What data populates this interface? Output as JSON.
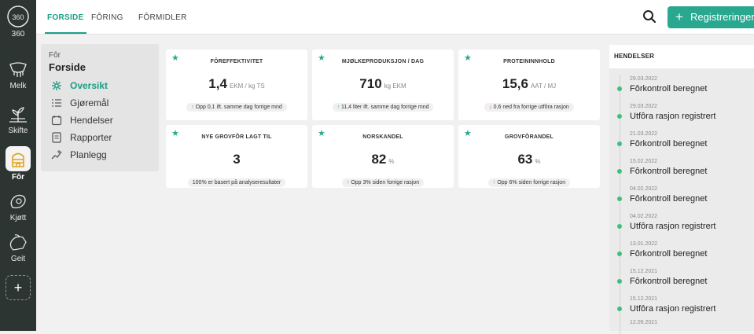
{
  "rail": {
    "items": [
      {
        "label": "360",
        "icon": "360-icon"
      },
      {
        "label": "Melk",
        "icon": "udder-icon"
      },
      {
        "label": "Skifte",
        "icon": "field-plant-icon"
      },
      {
        "label": "Fôr",
        "icon": "feed-silo-icon",
        "active": true
      },
      {
        "label": "Kjøtt",
        "icon": "meat-icon"
      },
      {
        "label": "Geit",
        "icon": "goat-icon"
      }
    ],
    "add_label": "+"
  },
  "topbar": {
    "tabs": [
      "FORSIDE",
      "FÔRING",
      "FÔRMIDLER"
    ],
    "active_tab": 0,
    "register_label": "Registreringer",
    "register_plus": "+"
  },
  "submenu": {
    "breadcrumb": "Fôr",
    "title": "Forside",
    "items": [
      {
        "label": "Oversikt",
        "icon": "overview-icon",
        "active": true
      },
      {
        "label": "Gjøremål",
        "icon": "checklist-icon"
      },
      {
        "label": "Hendelser",
        "icon": "calendar-icon"
      },
      {
        "label": "Rapporter",
        "icon": "report-icon"
      },
      {
        "label": "Planlegg",
        "icon": "plan-chart-icon"
      }
    ]
  },
  "cards": [
    {
      "title": "FÔREFFEKTIVITET",
      "value": "1,4",
      "unit": "EKM / kg TS",
      "badge": "Opp 0,1 ift. samme dag forrige mnd",
      "trend": "up",
      "arrow": "↑"
    },
    {
      "title": "MJØLKEPRODUKSJON / DAG",
      "value": "710",
      "unit": "kg EKM",
      "badge": "11,4 liter ift. samme dag forrige mnd",
      "trend": "up",
      "arrow": "↑"
    },
    {
      "title": "PROTEININNHOLD",
      "value": "15,6",
      "unit": "AAT / MJ",
      "badge": "0,6 ned fra forrige utfôra rasjon",
      "trend": "down",
      "arrow": "↓"
    },
    {
      "title": "NYE GROVFÔR LAGT TIL",
      "value": "3",
      "unit": "",
      "badge": "100% er basert på analyseresultater",
      "trend": "none",
      "arrow": ""
    },
    {
      "title": "NORSKANDEL",
      "value": "82",
      "unit": "%",
      "badge": "Opp 3% siden forrige rasjon",
      "trend": "up",
      "arrow": "↑"
    },
    {
      "title": "GROVFÔRANDEL",
      "value": "63",
      "unit": "%",
      "badge": "Opp 6% siden forrige rasjon",
      "trend": "up",
      "arrow": "↑"
    }
  ],
  "colors": {
    "accent": "#2aa88f",
    "rail": "#2c3532",
    "down": "#e23b3b",
    "event_dot": "#3fbf7f"
  },
  "events": {
    "heading": "HENDELSER",
    "items": [
      {
        "date": "29.03.2022",
        "title": "Fôrkontroll beregnet"
      },
      {
        "date": "29.03.2022",
        "title": "Utfôra rasjon registrert"
      },
      {
        "date": "21.03.2022",
        "title": "Fôrkontroll beregnet"
      },
      {
        "date": "15.02.2022",
        "title": "Fôrkontroll beregnet"
      },
      {
        "date": "04.02.2022",
        "title": "Fôrkontroll beregnet"
      },
      {
        "date": "04.02.2022",
        "title": "Utfôra rasjon registrert"
      },
      {
        "date": "13.01.2022",
        "title": "Fôrkontroll beregnet"
      },
      {
        "date": "15.12.2021",
        "title": "Fôrkontroll beregnet"
      },
      {
        "date": "15.12.2021",
        "title": "Utfôra rasjon registrert"
      },
      {
        "date": "12.09.2021",
        "title": ""
      }
    ]
  }
}
